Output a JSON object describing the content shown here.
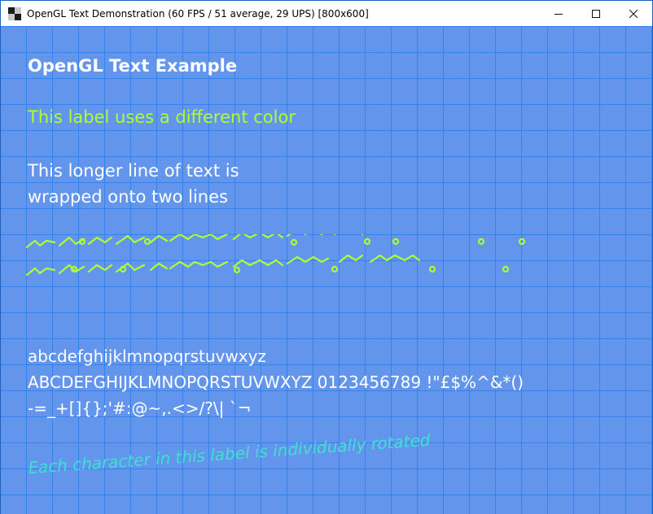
{
  "window": {
    "title": "OpenGL Text Demonstration (60 FPS / 51 average, 29 UPS) [800x600]",
    "controls": {
      "minimize_icon": "minimize-icon",
      "maximize_icon": "maximize-icon",
      "close_icon": "close-icon"
    }
  },
  "canvas": {
    "background_color": "#6495ed",
    "grid_color": "#2882f0",
    "heading": "OpenGL Text Example",
    "colored_label": "This label uses a different color",
    "colored_label_color": "#adff2f",
    "wrapped_line1": "This longer line of text is",
    "wrapped_line2": "wrapped onto two lines",
    "alphabet_lower": "abcdefghijklmnopqrstuvwxyz",
    "alphabet_upper": "ABCDEFGHIJKLMNOPQRSTUVWXYZ 0123456789 !\"£$%^&*()",
    "symbols": "-=_+[]{};'#:@~,.<>/?\\| `¬",
    "rotated_label": "Each character in this label is individually rotated",
    "rotated_label_color": "#40e0d0"
  }
}
